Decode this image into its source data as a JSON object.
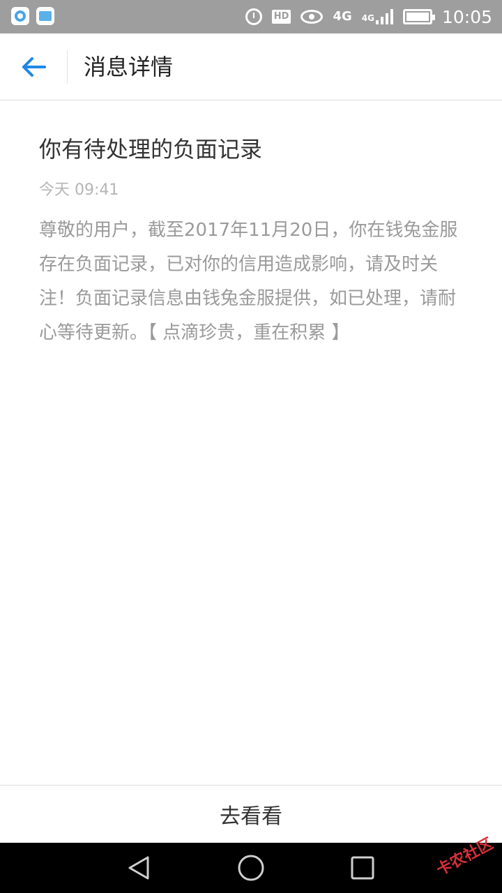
{
  "status_bar": {
    "hd_label": "HD",
    "net_label_1": "4G",
    "net_label_2": "4G",
    "time": "10:05",
    "icons": [
      "browser-app-icon",
      "wallet-app-icon",
      "alarm-icon",
      "eye-icon",
      "signal-icon",
      "battery-icon"
    ]
  },
  "header": {
    "title": "消息详情",
    "back_icon": "arrow-left-icon",
    "accent_color": "#1e88e5"
  },
  "message": {
    "title": "你有待处理的负面记录",
    "time": "今天 09:41",
    "body": "尊敬的用户，截至2017年11月20日，你在钱兔金服存在负面记录，已对你的信用造成影响，请及时关注！负面记录信息由钱兔金服提供，如已处理，请耐心等待更新。【 点滴珍贵，重在积累 】"
  },
  "bottom_action": {
    "label": "去看看"
  },
  "nav_bar": {
    "icons": [
      "triangle-back-icon",
      "circle-home-icon",
      "square-recent-icon"
    ]
  },
  "watermark": {
    "text": "卡农社区"
  }
}
